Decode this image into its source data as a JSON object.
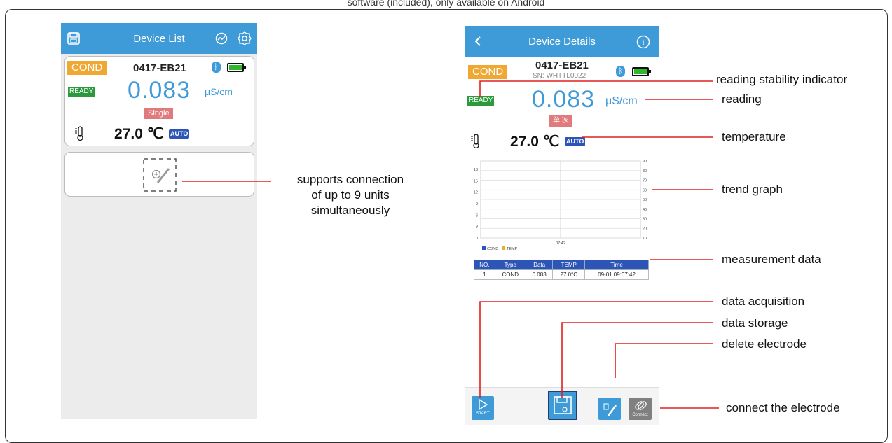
{
  "top_caption": "software (included), only available on Android",
  "left_phone": {
    "title": "Device List",
    "card": {
      "type": "COND",
      "device_id": "0417-EB21",
      "status": "READY",
      "reading": "0.083",
      "unit": "μS/cm",
      "mode": "Single",
      "temperature": "27.0 ℃",
      "temp_mode": "AUTO"
    }
  },
  "right_phone": {
    "title": "Device Details",
    "type": "COND",
    "device_id": "0417-EB21",
    "serial": "SN: WHTTL0022",
    "status": "READY",
    "reading": "0.083",
    "unit": "μS/cm",
    "mode": "单 次",
    "temperature": "27.0 ℃",
    "temp_mode": "AUTO",
    "chart": {
      "left_ticks": [
        "18",
        "15",
        "12",
        "9",
        "6",
        "3",
        "0"
      ],
      "right_ticks": [
        "90",
        "80",
        "70",
        "60",
        "50",
        "40",
        "30",
        "20",
        "10"
      ],
      "x_tick": "07:42",
      "legend": [
        "COND",
        "TEMP"
      ]
    },
    "table": {
      "headers": [
        "NO.",
        "Type",
        "Data",
        "TEMP",
        "Time"
      ],
      "rows": [
        [
          "1",
          "COND",
          "0.083",
          "27.0°C",
          "09-01 09:07:42"
        ]
      ]
    },
    "start_label": "START",
    "connect_label": "Connect"
  },
  "annotations": {
    "supports_line1": "supports connection",
    "supports_line2": "of up to 9 units",
    "supports_line3": "simultaneously",
    "stability": "reading stability indicator",
    "reading": "reading",
    "temperature": "temperature",
    "trend": "trend graph",
    "measurement": "measurement data",
    "acquisition": "data acquisition",
    "storage": "data storage",
    "delete": "delete electrode",
    "connect": "connect the electrode"
  },
  "colors": {
    "accent_blue": "#3e9bd7",
    "annotation_red": "#e02020",
    "cond_orange": "#f0a832",
    "ready_green": "#2a9a3c"
  }
}
